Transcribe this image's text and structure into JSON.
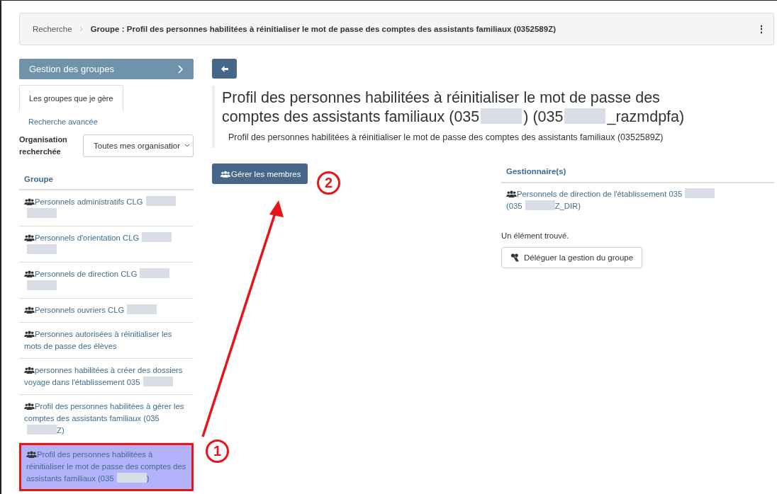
{
  "breadcrumb": {
    "items": [
      {
        "text": "Recherche",
        "current": false
      },
      {
        "text": "Groupe : Profil des personnes habilitées à réinitialiser le mot de passe des comptes des assistants familiaux (0352589Z)",
        "current": true
      }
    ],
    "menu_icon": "⋮"
  },
  "sidebar": {
    "header": "Gestion des groupes",
    "tabs": [
      {
        "label": "Les groupes que je gère",
        "selected": true
      },
      {
        "label": "Recherche avancée",
        "selected": false
      }
    ],
    "organisation": {
      "label": "Organisation recherchée",
      "value": "Toutes mes organisatior"
    },
    "list_heading": "Groupe",
    "items": [
      {
        "parts": [
          {
            "kind": "text",
            "text": "Personnels administratifs CLG"
          },
          {
            "kind": "blur"
          },
          {
            "kind": "break"
          },
          {
            "kind": "blur"
          }
        ],
        "selected": false,
        "highlighted": false
      },
      {
        "parts": [
          {
            "kind": "text",
            "text": "Personnels d'orientation CLG"
          },
          {
            "kind": "blur"
          },
          {
            "kind": "break"
          },
          {
            "kind": "blur"
          }
        ],
        "selected": false,
        "highlighted": false
      },
      {
        "parts": [
          {
            "kind": "text",
            "text": "Personnels de direction CLG"
          },
          {
            "kind": "blur"
          },
          {
            "kind": "break"
          },
          {
            "kind": "blur"
          }
        ],
        "selected": false,
        "highlighted": false
      },
      {
        "parts": [
          {
            "kind": "text",
            "text": "Personnels ouvriers CLG"
          },
          {
            "kind": "blur"
          }
        ],
        "selected": false,
        "highlighted": false
      },
      {
        "parts": [
          {
            "kind": "text",
            "text": "Personnes autorisées à réinitialiser les mots de passe des élèves"
          }
        ],
        "selected": false,
        "highlighted": false
      },
      {
        "parts": [
          {
            "kind": "text",
            "text": "personnes habilitées à créer des dossiers voyage dans l'établissement 035"
          },
          {
            "kind": "blur"
          }
        ],
        "selected": false,
        "highlighted": false
      },
      {
        "parts": [
          {
            "kind": "text",
            "text": "Profil des personnes habilitées à gérer les comptes des assistants familiaux (035"
          },
          {
            "kind": "blur"
          },
          {
            "kind": "text",
            "text": "Z)"
          }
        ],
        "selected": false,
        "highlighted": false
      },
      {
        "parts": [
          {
            "kind": "text",
            "text": "Profil des personnes habilitées à réinitialiser le mot de passe des comptes des assistants familiaux (035"
          },
          {
            "kind": "blur"
          },
          {
            "kind": "text",
            "text": ")"
          }
        ],
        "selected": true,
        "highlighted": true
      }
    ]
  },
  "main": {
    "title_parts": [
      {
        "kind": "text",
        "text": "Profil des personnes habilitées à réinitialiser le mot de passe des comptes des assistants familiaux (035"
      },
      {
        "kind": "blur"
      },
      {
        "kind": "text",
        "text": ") (035"
      },
      {
        "kind": "blur"
      },
      {
        "kind": "text",
        "text": "_razmdpfa)"
      }
    ],
    "subtitle": "Profil des personnes habilitées à réinitialiser le mot de passe des comptes des assistants familiaux (0352589Z)",
    "manage_button": "Gérer les membres",
    "managers": {
      "heading": "Gestionnaire(s)",
      "items": [
        {
          "parts": [
            {
              "kind": "text",
              "text": "Personnels de direction de l'établissement 035"
            },
            {
              "kind": "blur"
            },
            {
              "kind": "break"
            },
            {
              "kind": "text",
              "text": "(035"
            },
            {
              "kind": "blur"
            },
            {
              "kind": "text",
              "text": "Z_DIR)"
            }
          ]
        }
      ],
      "count": "Un élément trouvé.",
      "delegate_button": "Déléguer la gestion du groupe"
    }
  },
  "annotations": [
    {
      "label": "1"
    },
    {
      "label": "2"
    }
  ]
}
